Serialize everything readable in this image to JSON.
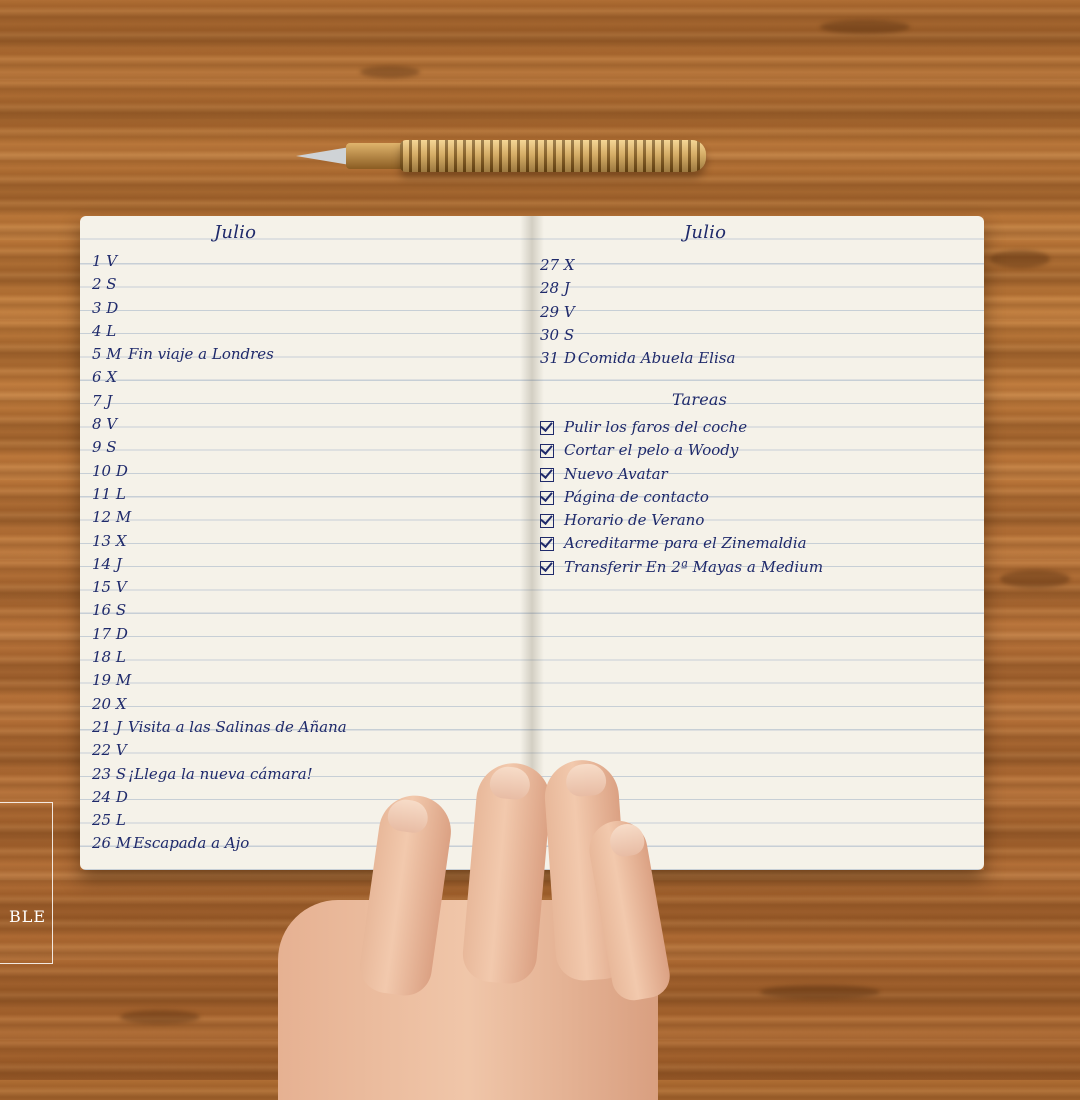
{
  "notebook": {
    "left_page": {
      "title": "Julio",
      "days": [
        {
          "num": "1 V",
          "entry": ""
        },
        {
          "num": "2 S",
          "entry": ""
        },
        {
          "num": "3 D",
          "entry": ""
        },
        {
          "num": "4 L",
          "entry": ""
        },
        {
          "num": "5 M",
          "entry": "Fin viaje a Londres"
        },
        {
          "num": "6 X",
          "entry": ""
        },
        {
          "num": "7 J",
          "entry": ""
        },
        {
          "num": "8 V",
          "entry": ""
        },
        {
          "num": "9 S",
          "entry": ""
        },
        {
          "num": "10 D",
          "entry": ""
        },
        {
          "num": "11 L",
          "entry": ""
        },
        {
          "num": "12 M",
          "entry": ""
        },
        {
          "num": "13 X",
          "entry": ""
        },
        {
          "num": "14 J",
          "entry": ""
        },
        {
          "num": "15 V",
          "entry": ""
        },
        {
          "num": "16 S",
          "entry": ""
        },
        {
          "num": "17 D",
          "entry": ""
        },
        {
          "num": "18 L",
          "entry": ""
        },
        {
          "num": "19 M",
          "entry": ""
        },
        {
          "num": "20 X",
          "entry": ""
        },
        {
          "num": "21 J",
          "entry": "Visita a las Salinas de Añana"
        },
        {
          "num": "22 V",
          "entry": ""
        },
        {
          "num": "23 S",
          "entry": "¡Llega la nueva cámara!"
        },
        {
          "num": "24 D",
          "entry": ""
        },
        {
          "num": "25 L",
          "entry": ""
        },
        {
          "num": "26 M",
          "entry": "Escapada a Ajo"
        }
      ]
    },
    "right_page": {
      "title": "Julio",
      "days": [
        {
          "num": "27 X",
          "entry": ""
        },
        {
          "num": "28 J",
          "entry": ""
        },
        {
          "num": "29 V",
          "entry": ""
        },
        {
          "num": "30 S",
          "entry": ""
        },
        {
          "num": "31 D",
          "entry": "Comida Abuela Elisa"
        }
      ],
      "tasks_title": "Tareas",
      "tasks": [
        "Pulir los faros del coche",
        "Cortar el pelo a Woody",
        "Nuevo Avatar",
        "Página de contacto",
        "Horario de Verano",
        "Acreditarme para el Zinemaldia",
        "Transferir En 2ª Mayas a Medium"
      ]
    }
  },
  "watermark": {
    "text": "BLE"
  }
}
